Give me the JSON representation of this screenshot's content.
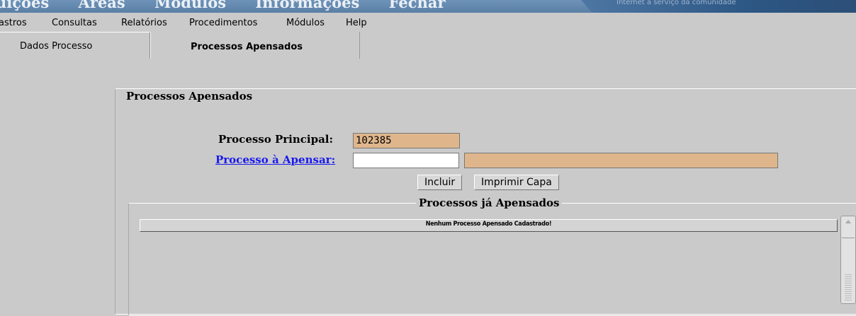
{
  "topbar": {
    "nav": [
      "uições",
      "Áreas",
      "Módulos",
      "Informações",
      "Fechar"
    ],
    "tagline": "Internet a serviço da comunidade"
  },
  "menubar": [
    "astros",
    "Consultas",
    "Relatórios",
    "Procedimentos",
    "Módulos",
    "Help"
  ],
  "tabs": [
    "Dados Processo",
    "Processos Apensados"
  ],
  "form": {
    "legend": "Processos Apensados",
    "principal_label": "Processo Principal:",
    "principal_value": "102385",
    "apensar_label": "Processo à Apensar:",
    "apensar_value": "",
    "desc_value": ""
  },
  "buttons": {
    "incluir": "Incluir",
    "imprimir": "Imprimir Capa"
  },
  "list": {
    "legend": "Processos já Apensados",
    "empty_message": "Nenhum Processo Apensado Cadastrado!"
  }
}
